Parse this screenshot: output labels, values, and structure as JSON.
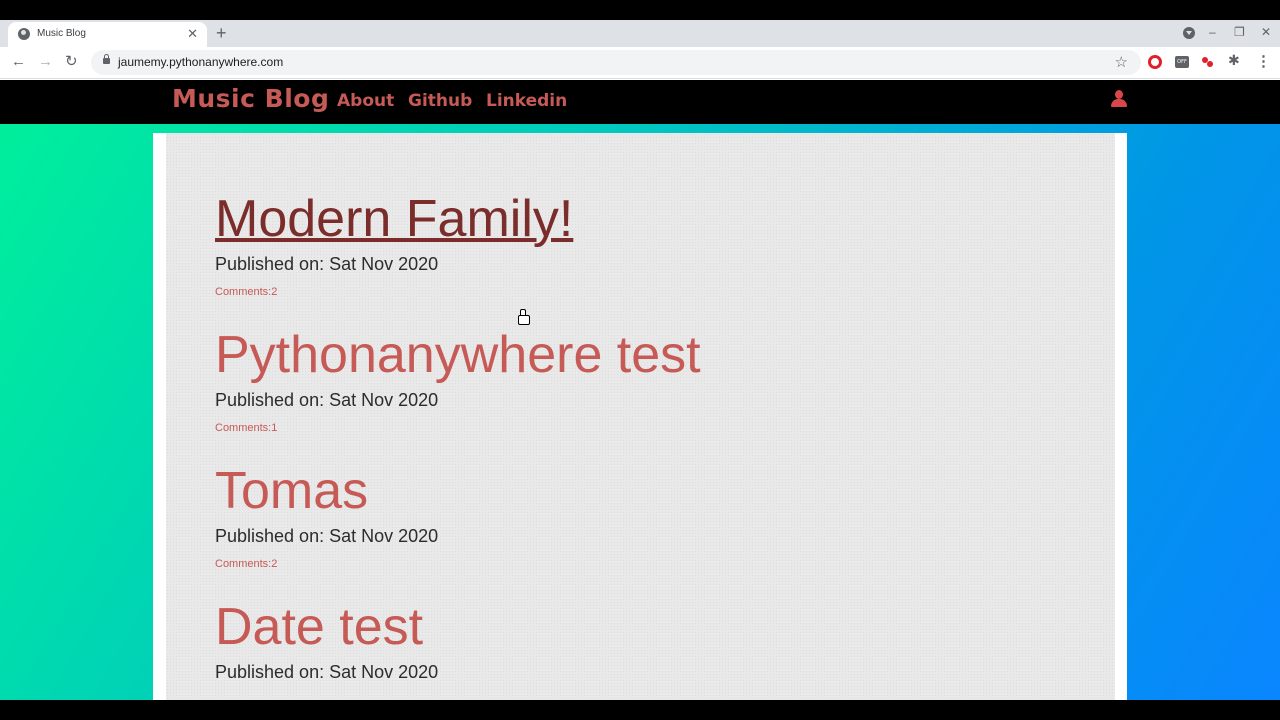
{
  "browser": {
    "tab_title": "Music Blog",
    "tab_close": "✕",
    "new_tab": "+",
    "url": "jaumemy.pythonanywhere.com",
    "win_minimize": "–",
    "win_restore": "❐",
    "win_close": "✕",
    "back": "←",
    "forward": "→",
    "reload": "↻",
    "bookmark": "☆",
    "ext_off_label": "OFF",
    "puzzle": "✱",
    "menu": "⋮"
  },
  "nav": {
    "brand": "Music Blog",
    "links": [
      "About",
      "Github",
      "Linkedin"
    ]
  },
  "posts": [
    {
      "title": "Modern Family!",
      "date": "Published on: Sat Nov 2020",
      "comments": "Comments:2"
    },
    {
      "title": "Pythonanywhere test",
      "date": "Published on: Sat Nov 2020",
      "comments": "Comments:1"
    },
    {
      "title": "Tomas",
      "date": "Published on: Sat Nov 2020",
      "comments": "Comments:2"
    },
    {
      "title": "Date test",
      "date": "Published on: Sat Nov 2020",
      "comments": ""
    }
  ],
  "colors": {
    "accent": "#c65a56",
    "link_active": "#7a2d2a",
    "navbar_bg": "#000000",
    "gradient_start": "#00f09a",
    "gradient_end": "#0a86ff"
  }
}
